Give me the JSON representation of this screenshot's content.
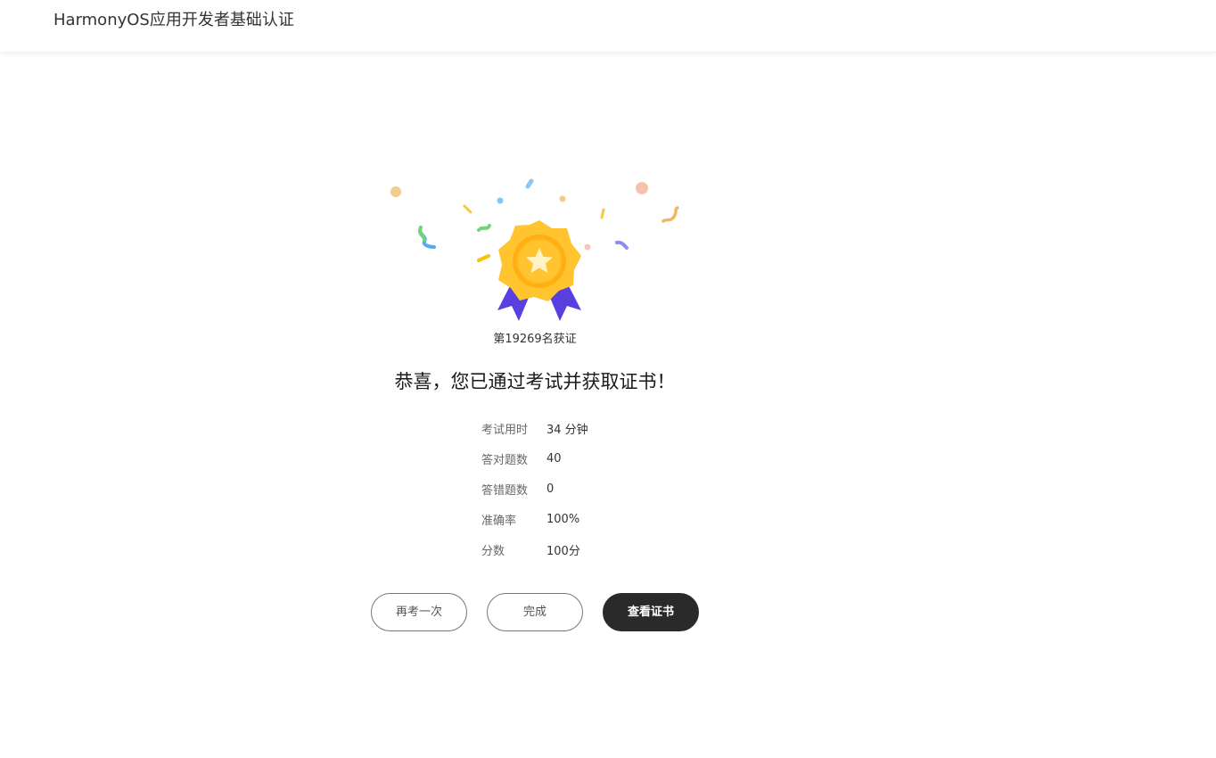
{
  "header": {
    "title": "HarmonyOS应用开发者基础认证"
  },
  "result": {
    "badge_icon": "medal-badge-icon",
    "rank_text": "第19269名获证",
    "congrats_text": "恭喜，您已通过考试并获取证书！",
    "stats": [
      {
        "label": "考试用时",
        "value": "34 分钟"
      },
      {
        "label": "答对题数",
        "value": "40"
      },
      {
        "label": "答错题数",
        "value": "0"
      },
      {
        "label": "准确率",
        "value": "100%"
      },
      {
        "label": "分数",
        "value": "100分"
      }
    ]
  },
  "actions": {
    "retake_label": "再考一次",
    "finish_label": "完成",
    "view_cert_label": "查看证书"
  },
  "colors": {
    "badge_gold": "#FFC42E",
    "ribbon_purple": "#5A3FE0",
    "primary_button": "#2A2A2A"
  }
}
